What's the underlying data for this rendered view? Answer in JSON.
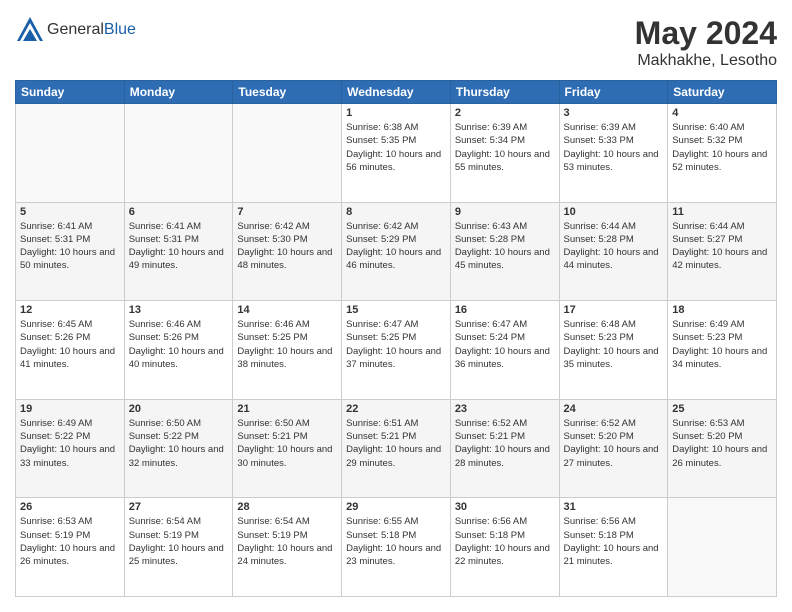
{
  "logo": {
    "general": "General",
    "blue": "Blue"
  },
  "title": {
    "month_year": "May 2024",
    "location": "Makhakhe, Lesotho"
  },
  "weekdays": [
    "Sunday",
    "Monday",
    "Tuesday",
    "Wednesday",
    "Thursday",
    "Friday",
    "Saturday"
  ],
  "weeks": [
    [
      {
        "day": "",
        "info": ""
      },
      {
        "day": "",
        "info": ""
      },
      {
        "day": "",
        "info": ""
      },
      {
        "day": "1",
        "info": "Sunrise: 6:38 AM\nSunset: 5:35 PM\nDaylight: 10 hours and 56 minutes."
      },
      {
        "day": "2",
        "info": "Sunrise: 6:39 AM\nSunset: 5:34 PM\nDaylight: 10 hours and 55 minutes."
      },
      {
        "day": "3",
        "info": "Sunrise: 6:39 AM\nSunset: 5:33 PM\nDaylight: 10 hours and 53 minutes."
      },
      {
        "day": "4",
        "info": "Sunrise: 6:40 AM\nSunset: 5:32 PM\nDaylight: 10 hours and 52 minutes."
      }
    ],
    [
      {
        "day": "5",
        "info": "Sunrise: 6:41 AM\nSunset: 5:31 PM\nDaylight: 10 hours and 50 minutes."
      },
      {
        "day": "6",
        "info": "Sunrise: 6:41 AM\nSunset: 5:31 PM\nDaylight: 10 hours and 49 minutes."
      },
      {
        "day": "7",
        "info": "Sunrise: 6:42 AM\nSunset: 5:30 PM\nDaylight: 10 hours and 48 minutes."
      },
      {
        "day": "8",
        "info": "Sunrise: 6:42 AM\nSunset: 5:29 PM\nDaylight: 10 hours and 46 minutes."
      },
      {
        "day": "9",
        "info": "Sunrise: 6:43 AM\nSunset: 5:28 PM\nDaylight: 10 hours and 45 minutes."
      },
      {
        "day": "10",
        "info": "Sunrise: 6:44 AM\nSunset: 5:28 PM\nDaylight: 10 hours and 44 minutes."
      },
      {
        "day": "11",
        "info": "Sunrise: 6:44 AM\nSunset: 5:27 PM\nDaylight: 10 hours and 42 minutes."
      }
    ],
    [
      {
        "day": "12",
        "info": "Sunrise: 6:45 AM\nSunset: 5:26 PM\nDaylight: 10 hours and 41 minutes."
      },
      {
        "day": "13",
        "info": "Sunrise: 6:46 AM\nSunset: 5:26 PM\nDaylight: 10 hours and 40 minutes."
      },
      {
        "day": "14",
        "info": "Sunrise: 6:46 AM\nSunset: 5:25 PM\nDaylight: 10 hours and 38 minutes."
      },
      {
        "day": "15",
        "info": "Sunrise: 6:47 AM\nSunset: 5:25 PM\nDaylight: 10 hours and 37 minutes."
      },
      {
        "day": "16",
        "info": "Sunrise: 6:47 AM\nSunset: 5:24 PM\nDaylight: 10 hours and 36 minutes."
      },
      {
        "day": "17",
        "info": "Sunrise: 6:48 AM\nSunset: 5:23 PM\nDaylight: 10 hours and 35 minutes."
      },
      {
        "day": "18",
        "info": "Sunrise: 6:49 AM\nSunset: 5:23 PM\nDaylight: 10 hours and 34 minutes."
      }
    ],
    [
      {
        "day": "19",
        "info": "Sunrise: 6:49 AM\nSunset: 5:22 PM\nDaylight: 10 hours and 33 minutes."
      },
      {
        "day": "20",
        "info": "Sunrise: 6:50 AM\nSunset: 5:22 PM\nDaylight: 10 hours and 32 minutes."
      },
      {
        "day": "21",
        "info": "Sunrise: 6:50 AM\nSunset: 5:21 PM\nDaylight: 10 hours and 30 minutes."
      },
      {
        "day": "22",
        "info": "Sunrise: 6:51 AM\nSunset: 5:21 PM\nDaylight: 10 hours and 29 minutes."
      },
      {
        "day": "23",
        "info": "Sunrise: 6:52 AM\nSunset: 5:21 PM\nDaylight: 10 hours and 28 minutes."
      },
      {
        "day": "24",
        "info": "Sunrise: 6:52 AM\nSunset: 5:20 PM\nDaylight: 10 hours and 27 minutes."
      },
      {
        "day": "25",
        "info": "Sunrise: 6:53 AM\nSunset: 5:20 PM\nDaylight: 10 hours and 26 minutes."
      }
    ],
    [
      {
        "day": "26",
        "info": "Sunrise: 6:53 AM\nSunset: 5:19 PM\nDaylight: 10 hours and 26 minutes."
      },
      {
        "day": "27",
        "info": "Sunrise: 6:54 AM\nSunset: 5:19 PM\nDaylight: 10 hours and 25 minutes."
      },
      {
        "day": "28",
        "info": "Sunrise: 6:54 AM\nSunset: 5:19 PM\nDaylight: 10 hours and 24 minutes."
      },
      {
        "day": "29",
        "info": "Sunrise: 6:55 AM\nSunset: 5:18 PM\nDaylight: 10 hours and 23 minutes."
      },
      {
        "day": "30",
        "info": "Sunrise: 6:56 AM\nSunset: 5:18 PM\nDaylight: 10 hours and 22 minutes."
      },
      {
        "day": "31",
        "info": "Sunrise: 6:56 AM\nSunset: 5:18 PM\nDaylight: 10 hours and 21 minutes."
      },
      {
        "day": "",
        "info": ""
      }
    ]
  ]
}
